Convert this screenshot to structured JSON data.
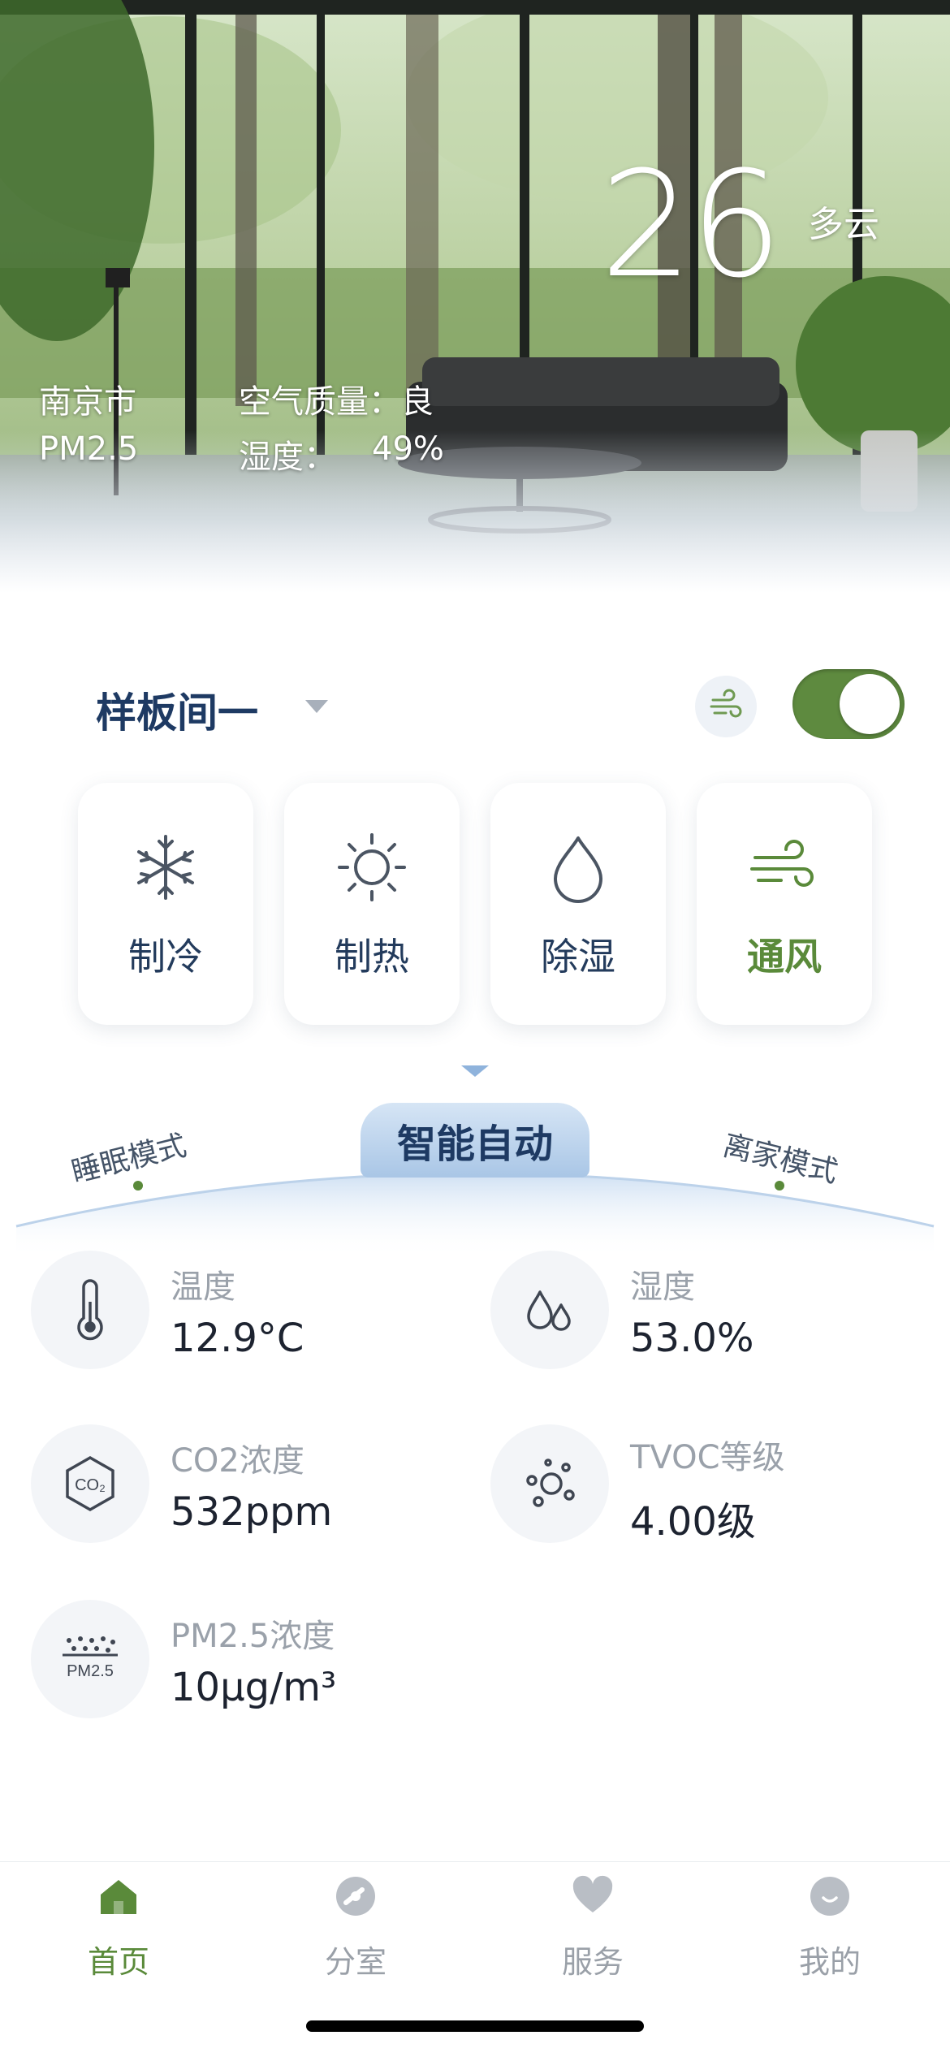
{
  "hero": {
    "temperature": "26",
    "weather": "多云",
    "city": "南京市",
    "air_quality": "空气质量：良",
    "pm25_label": "PM2.5",
    "humidity_label": "湿度：",
    "humidity_value": "49%"
  },
  "room": {
    "name": "样板间一",
    "power_on": true
  },
  "modes": [
    {
      "label": "制冷",
      "icon": "snowflake-icon",
      "active": false
    },
    {
      "label": "制热",
      "icon": "sun-icon",
      "active": false
    },
    {
      "label": "除湿",
      "icon": "droplet-icon",
      "active": false
    },
    {
      "label": "通风",
      "icon": "wind-icon",
      "active": true
    }
  ],
  "scene": {
    "current": "智能自动",
    "left": "睡眠模式",
    "right": "离家模式"
  },
  "sensors": [
    {
      "label": "温度",
      "value": "12.9°C",
      "icon": "thermometer-icon"
    },
    {
      "label": "湿度",
      "value": "53.0%",
      "icon": "humidity-drops-icon"
    },
    {
      "label": "CO2浓度",
      "value": "532ppm",
      "icon": "co2-icon"
    },
    {
      "label": "TVOC等级",
      "value": "4.00级",
      "icon": "tvoc-bubbles-icon"
    },
    {
      "label": "PM2.5浓度",
      "value": "10μg/m³",
      "icon": "pm25-icon"
    }
  ],
  "tabs": [
    {
      "label": "首页",
      "icon": "home-icon",
      "active": true
    },
    {
      "label": "分室",
      "icon": "room-icon",
      "active": false
    },
    {
      "label": "服务",
      "icon": "heart-icon",
      "active": false
    },
    {
      "label": "我的",
      "icon": "profile-icon",
      "active": false
    }
  ],
  "colors": {
    "accent_green": "#5a8a3a",
    "navy": "#1e3a63",
    "muted": "#9aa1aa"
  }
}
